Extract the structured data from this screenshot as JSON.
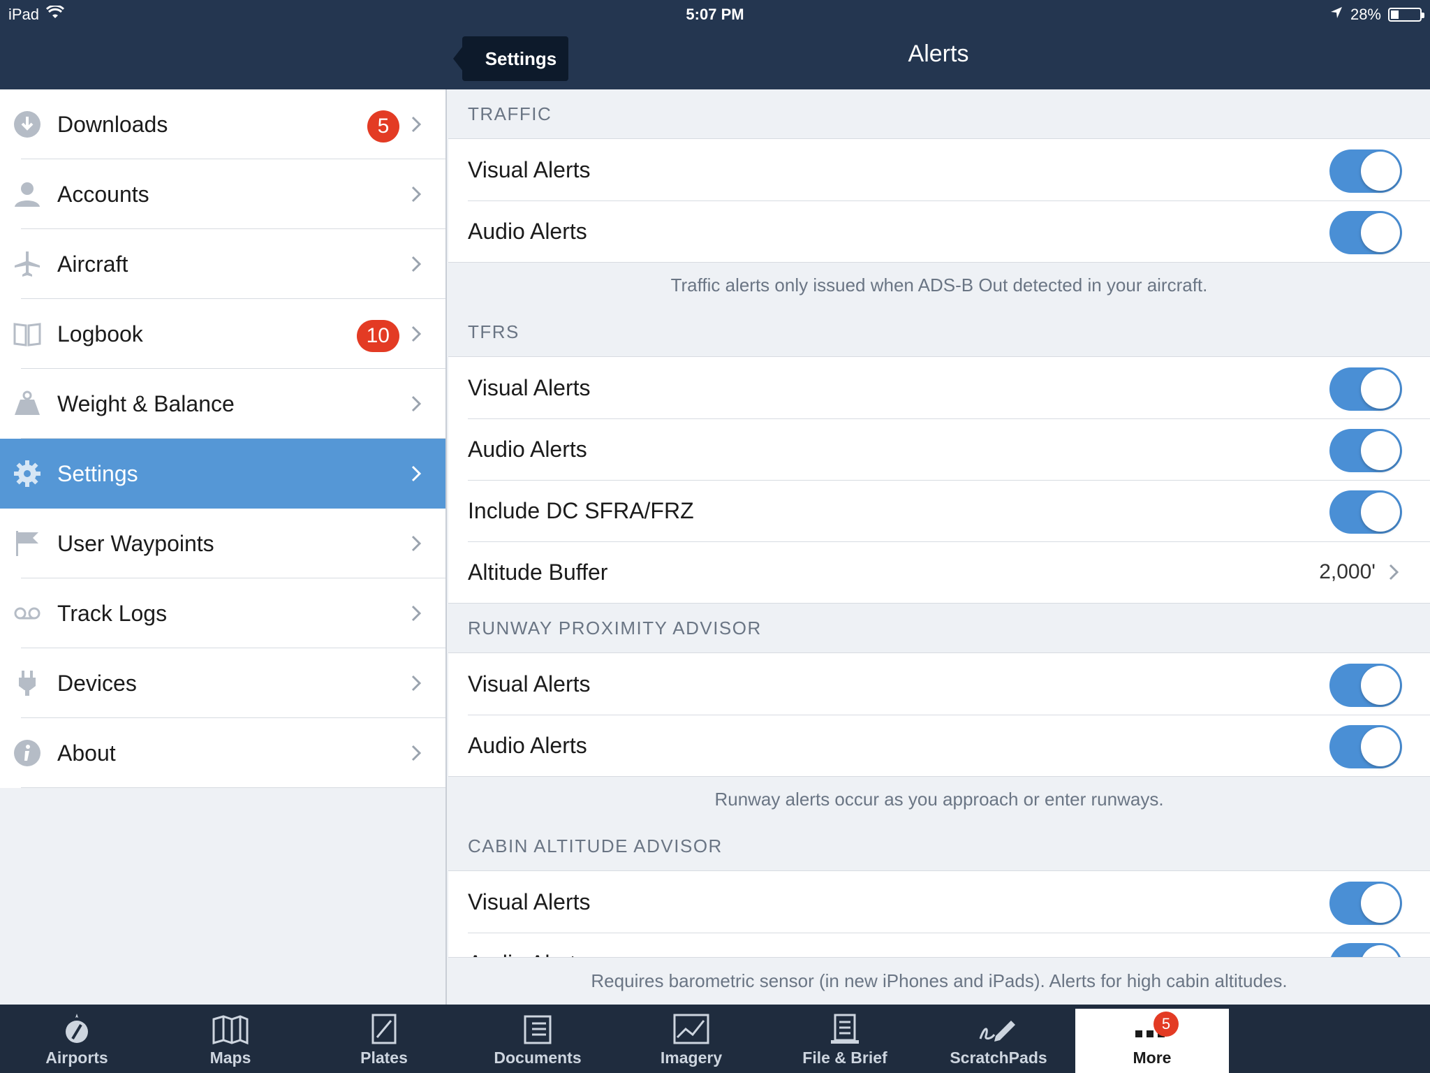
{
  "status_bar": {
    "device": "iPad",
    "time": "5:07 PM",
    "battery": "28%"
  },
  "nav": {
    "back_label": "Settings",
    "title": "Alerts"
  },
  "sidebar": {
    "items": [
      {
        "label": "Downloads",
        "badge": "5"
      },
      {
        "label": "Accounts"
      },
      {
        "label": "Aircraft"
      },
      {
        "label": "Logbook",
        "badge": "10"
      },
      {
        "label": "Weight & Balance"
      },
      {
        "label": "Settings",
        "active": true
      },
      {
        "label": "User Waypoints"
      },
      {
        "label": "Track Logs"
      },
      {
        "label": "Devices"
      },
      {
        "label": "About"
      }
    ]
  },
  "alerts": {
    "traffic": {
      "header": "TRAFFIC",
      "visual": "Visual Alerts",
      "audio": "Audio Alerts",
      "footer": "Traffic alerts only issued when ADS-B Out detected in your aircraft."
    },
    "tfrs": {
      "header": "TFRS",
      "visual": "Visual Alerts",
      "audio": "Audio Alerts",
      "dc": "Include DC SFRA/FRZ",
      "altitude_label": "Altitude Buffer",
      "altitude_value": "2,000'"
    },
    "runway": {
      "header": "RUNWAY PROXIMITY ADVISOR",
      "visual": "Visual Alerts",
      "audio": "Audio Alerts",
      "footer": "Runway alerts occur as you approach or enter runways."
    },
    "cabin": {
      "header": "CABIN ALTITUDE ADVISOR",
      "visual": "Visual Alerts",
      "audio": "Audio Alerts",
      "footer": "Requires barometric sensor (in new iPhones and iPads). Alerts for high cabin altitudes."
    }
  },
  "tabbar": {
    "tabs": [
      "Airports",
      "Maps",
      "Plates",
      "Documents",
      "Imagery",
      "File & Brief",
      "ScratchPads",
      "More"
    ],
    "more_badge": "5"
  },
  "colors": {
    "navbar": "#243650",
    "accent": "#5597d6",
    "toggle_on": "#4a8fd5",
    "badge": "#e33b24",
    "tabbar": "#1f2c3e"
  }
}
